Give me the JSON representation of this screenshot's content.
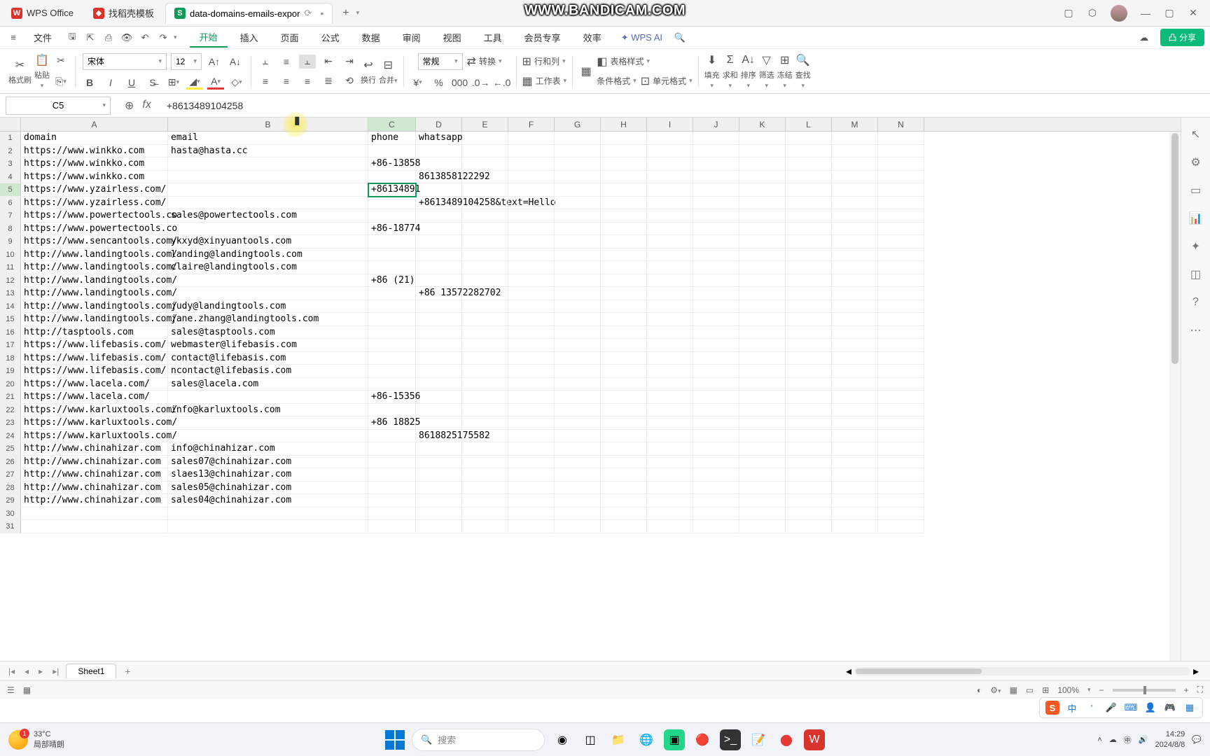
{
  "watermark": "WWW.BANDICAM.COM",
  "tabs": {
    "app": "WPS Office",
    "template": "找稻壳模板",
    "active": "data-domains-emails-expor",
    "new": "+"
  },
  "menu": {
    "hamburger": "≡",
    "file": "文件",
    "items": [
      "开始",
      "插入",
      "页面",
      "公式",
      "数据",
      "审阅",
      "视图",
      "工具",
      "会员专享",
      "效率"
    ],
    "active_index": 0,
    "wps_ai": "WPS AI",
    "cloud": "⟲",
    "share": "凸 分享"
  },
  "ribbon": {
    "format_painter": "格式刷",
    "paste": "粘贴",
    "font_name": "宋体",
    "font_size": "12",
    "number_format": "常规",
    "convert": "转换",
    "row_col": "行和列",
    "worksheet": "工作表",
    "table_style": "表格样式",
    "cond_fmt": "条件格式",
    "cell_fmt": "单元格式",
    "fill": "填充",
    "sum": "求和",
    "sort": "排序",
    "filter": "筛选",
    "freeze": "冻结",
    "find": "查找"
  },
  "namebox": "C5",
  "formula": "+8613489104258",
  "columns": [
    "A",
    "B",
    "C",
    "D",
    "E",
    "F",
    "G",
    "H",
    "I",
    "J",
    "K",
    "L",
    "M",
    "N"
  ],
  "selected_col": "C",
  "selected_row": 5,
  "rows": [
    {
      "n": 1,
      "A": "domain",
      "B": "email",
      "C": "phone",
      "D": "whatsapp"
    },
    {
      "n": 2,
      "A": "https://www.winkko.com",
      "B": "hasta@hasta.cc"
    },
    {
      "n": 3,
      "A": "https://www.winkko.com",
      "C": "+86-13858"
    },
    {
      "n": 4,
      "A": "https://www.winkko.com",
      "D": "8613858122292"
    },
    {
      "n": 5,
      "A": "https://www.yzairless.com/",
      "C": "+86134891"
    },
    {
      "n": 6,
      "A": "https://www.yzairless.com/",
      "D": "+8613489104258&text=Hello"
    },
    {
      "n": 7,
      "A": "https://www.powertectools.co",
      "B": "sales@powertectools.com"
    },
    {
      "n": 8,
      "A": "https://www.powertectools.co",
      "C": "+86-18774"
    },
    {
      "n": 9,
      "A": "https://www.sencantools.com/",
      "B": "ykxyd@xinyuantools.com"
    },
    {
      "n": 10,
      "A": "http://www.landingtools.com/",
      "B": "landing@landingtools.com"
    },
    {
      "n": 11,
      "A": "http://www.landingtools.com/",
      "B": "claire@landingtools.com"
    },
    {
      "n": 12,
      "A": "http://www.landingtools.com/",
      "C": "+86 (21)"
    },
    {
      "n": 13,
      "A": "http://www.landingtools.com/",
      "D": "+86  13572282702"
    },
    {
      "n": 14,
      "A": "http://www.landingtools.com/",
      "B": "judy@landingtools.com"
    },
    {
      "n": 15,
      "A": "http://www.landingtools.com/",
      "B": "jane.zhang@landingtools.com"
    },
    {
      "n": 16,
      "A": "http://tasptools.com",
      "B": "sales@tasptools.com"
    },
    {
      "n": 17,
      "A": "https://www.lifebasis.com/",
      "B": "webmaster@lifebasis.com"
    },
    {
      "n": 18,
      "A": "https://www.lifebasis.com/",
      "B": "contact@lifebasis.com"
    },
    {
      "n": 19,
      "A": "https://www.lifebasis.com/",
      "B": "ncontact@lifebasis.com"
    },
    {
      "n": 20,
      "A": "https://www.lacela.com/",
      "B": "sales@lacela.com"
    },
    {
      "n": 21,
      "A": "https://www.lacela.com/",
      "C": "+86-15356"
    },
    {
      "n": 22,
      "A": "https://www.karluxtools.com/",
      "B": "info@karluxtools.com"
    },
    {
      "n": 23,
      "A": "https://www.karluxtools.com/",
      "C": "+86 18825"
    },
    {
      "n": 24,
      "A": "https://www.karluxtools.com/",
      "D": "8618825175582"
    },
    {
      "n": 25,
      "A": "http://www.chinahizar.com",
      "B": "info@chinahizar.com"
    },
    {
      "n": 26,
      "A": "http://www.chinahizar.com",
      "B": "sales07@chinahizar.com"
    },
    {
      "n": 27,
      "A": "http://www.chinahizar.com",
      "B": "slaes13@chinahizar.com"
    },
    {
      "n": 28,
      "A": "http://www.chinahizar.com",
      "B": "sales05@chinahizar.com"
    },
    {
      "n": 29,
      "A": "http://www.chinahizar.com",
      "B": "sales04@chinahizar.com"
    },
    {
      "n": 30
    },
    {
      "n": 31
    }
  ],
  "sheets": {
    "active": "Sheet1"
  },
  "status": {
    "zoom": "100%"
  },
  "taskbar": {
    "temp": "33°C",
    "weather": "局部晴朗",
    "weather_badge": "1",
    "search": "搜索",
    "time": "14:29",
    "date": "2024/8/8"
  },
  "ime": {
    "logo": "S",
    "lang": "中"
  }
}
